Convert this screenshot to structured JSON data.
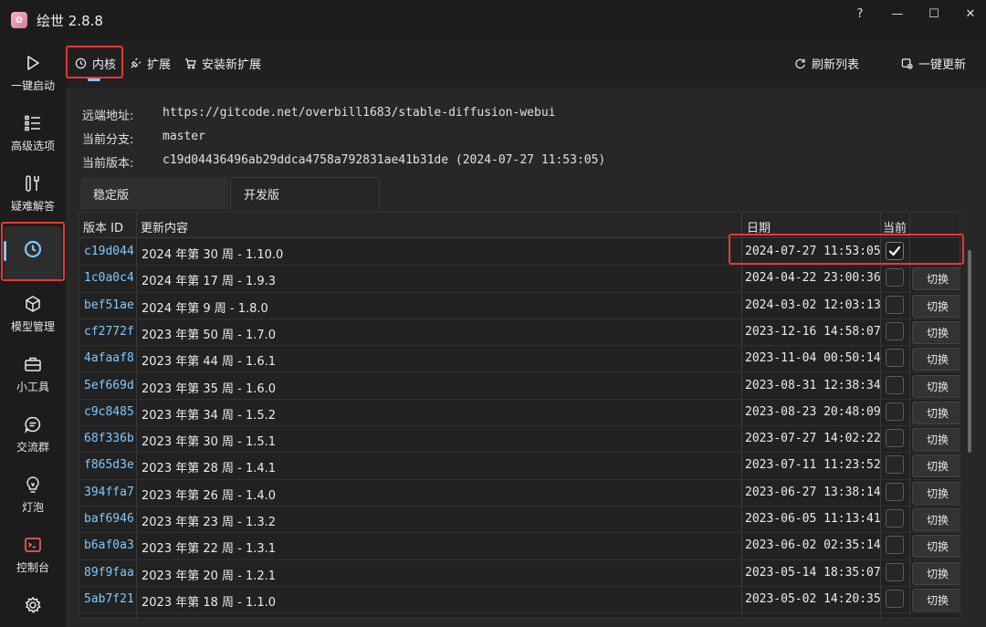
{
  "app": {
    "title": "绘世 2.8.8",
    "accent": "#7fc8ff",
    "highlight": "#e53935"
  },
  "window_controls": {
    "help": "?",
    "minimize": "—",
    "maximize": "☐",
    "close": "✕"
  },
  "sidebar": {
    "items": [
      {
        "label": "一键启动",
        "icon": "play-icon"
      },
      {
        "label": "高级选项",
        "icon": "list-icon"
      },
      {
        "label": "疑难解答",
        "icon": "tools-icon"
      },
      {
        "label": "",
        "icon": "history-icon",
        "active": true
      },
      {
        "label": "模型管理",
        "icon": "cube-icon"
      },
      {
        "label": "小工具",
        "icon": "toolbox-icon"
      },
      {
        "label": "交流群",
        "icon": "chat-icon"
      },
      {
        "label": "灯泡",
        "icon": "bulb-icon"
      },
      {
        "label": "控制台",
        "icon": "terminal-icon"
      },
      {
        "label": "",
        "icon": "settings-icon"
      }
    ]
  },
  "toolbar": {
    "kernel": "内核",
    "extensions": "扩展",
    "install_extension": "安装新扩展",
    "refresh_list": "刷新列表",
    "one_click_update": "一键更新"
  },
  "info": {
    "remote_label": "远端地址:",
    "remote_value": "https://gitcode.net/overbill1683/stable-diffusion-webui",
    "branch_label": "当前分支:",
    "branch_value": "master",
    "version_label": "当前版本:",
    "version_value": "c19d04436496ab29ddca4758a792831ae41b31de (2024-07-27 11:53:05)"
  },
  "tabs": [
    {
      "label": "稳定版",
      "active": true
    },
    {
      "label": "开发版",
      "active": false
    }
  ],
  "table": {
    "headers": {
      "id": "版本 ID",
      "content": "更新内容",
      "date": "日期",
      "current": "当前"
    },
    "switch_label": "切换",
    "rows": [
      {
        "id": "c19d044",
        "content": "2024 年第 30 周 - 1.10.0",
        "date": "2024-07-27 11:53:05",
        "current": true
      },
      {
        "id": "1c0a0c4",
        "content": "2024 年第 17 周 - 1.9.3",
        "date": "2024-04-22 23:00:36",
        "current": false
      },
      {
        "id": "bef51ae",
        "content": "2024 年第 9 周 - 1.8.0",
        "date": "2024-03-02 12:03:13",
        "current": false
      },
      {
        "id": "cf2772f",
        "content": "2023 年第 50 周 - 1.7.0",
        "date": "2023-12-16 14:58:07",
        "current": false
      },
      {
        "id": "4afaaf8",
        "content": "2023 年第 44 周 - 1.6.1",
        "date": "2023-11-04 00:50:14",
        "current": false
      },
      {
        "id": "5ef669d",
        "content": "2023 年第 35 周 - 1.6.0",
        "date": "2023-08-31 12:38:34",
        "current": false
      },
      {
        "id": "c9c8485",
        "content": "2023 年第 34 周 - 1.5.2",
        "date": "2023-08-23 20:48:09",
        "current": false
      },
      {
        "id": "68f336b",
        "content": "2023 年第 30 周 - 1.5.1",
        "date": "2023-07-27 14:02:22",
        "current": false
      },
      {
        "id": "f865d3e",
        "content": "2023 年第 28 周 - 1.4.1",
        "date": "2023-07-11 11:23:52",
        "current": false
      },
      {
        "id": "394ffa7",
        "content": "2023 年第 26 周 - 1.4.0",
        "date": "2023-06-27 13:38:14",
        "current": false
      },
      {
        "id": "baf6946",
        "content": "2023 年第 23 周 - 1.3.2",
        "date": "2023-06-05 11:13:41",
        "current": false
      },
      {
        "id": "b6af0a3",
        "content": "2023 年第 22 周 - 1.3.1",
        "date": "2023-06-02 02:35:14",
        "current": false
      },
      {
        "id": "89f9faa",
        "content": "2023 年第 20 周 - 1.2.1",
        "date": "2023-05-14 18:35:07",
        "current": false
      },
      {
        "id": "5ab7f21",
        "content": "2023 年第 18 周 - 1.1.0",
        "date": "2023-05-02 14:20:35",
        "current": false
      }
    ]
  }
}
